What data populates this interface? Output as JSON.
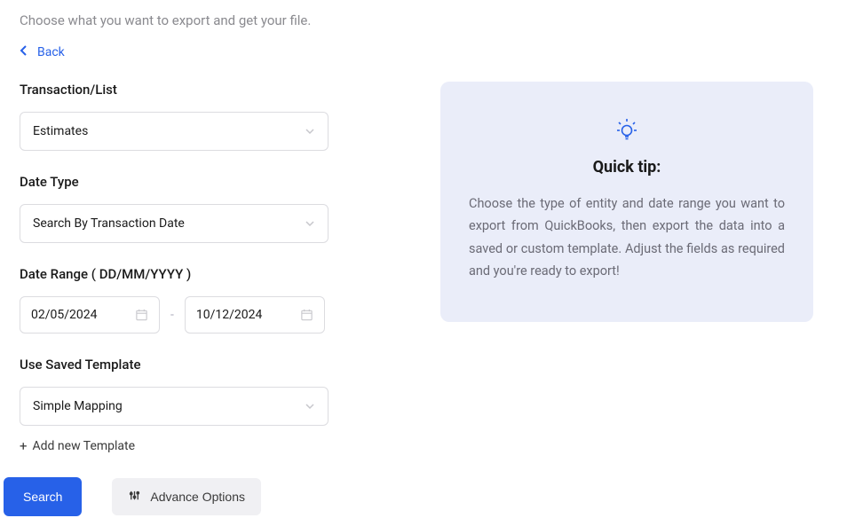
{
  "subtitle": "Choose what you want to export and get your file.",
  "back_link": "Back",
  "form": {
    "transaction_list": {
      "label": "Transaction/List",
      "value": "Estimates"
    },
    "date_type": {
      "label": "Date Type",
      "value": "Search By Transaction Date"
    },
    "date_range": {
      "label": "Date Range ( DD/MM/YYYY )",
      "from": "02/05/2024",
      "to": "10/12/2024",
      "separator": "-"
    },
    "template": {
      "label": "Use Saved Template",
      "value": "Simple Mapping",
      "add_link": "Add new Template"
    }
  },
  "buttons": {
    "search": "Search",
    "advance": "Advance Options"
  },
  "tip": {
    "title": "Quick tip:",
    "text": "Choose the type of entity and date range you want to export from QuickBooks, then export the data into a saved or custom template. Adjust the fields as required and you're ready to export!"
  },
  "colors": {
    "primary": "#2761e8",
    "panel_bg": "#eaedf9"
  }
}
